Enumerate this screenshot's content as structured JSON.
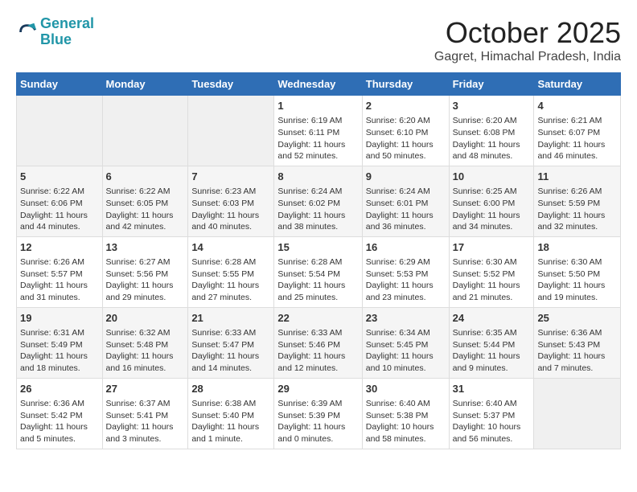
{
  "logo": {
    "line1": "General",
    "line2": "Blue"
  },
  "title": "October 2025",
  "subtitle": "Gagret, Himachal Pradesh, India",
  "weekdays": [
    "Sunday",
    "Monday",
    "Tuesday",
    "Wednesday",
    "Thursday",
    "Friday",
    "Saturday"
  ],
  "weeks": [
    [
      {
        "day": "",
        "info": ""
      },
      {
        "day": "",
        "info": ""
      },
      {
        "day": "",
        "info": ""
      },
      {
        "day": "1",
        "info": "Sunrise: 6:19 AM\nSunset: 6:11 PM\nDaylight: 11 hours\nand 52 minutes."
      },
      {
        "day": "2",
        "info": "Sunrise: 6:20 AM\nSunset: 6:10 PM\nDaylight: 11 hours\nand 50 minutes."
      },
      {
        "day": "3",
        "info": "Sunrise: 6:20 AM\nSunset: 6:08 PM\nDaylight: 11 hours\nand 48 minutes."
      },
      {
        "day": "4",
        "info": "Sunrise: 6:21 AM\nSunset: 6:07 PM\nDaylight: 11 hours\nand 46 minutes."
      }
    ],
    [
      {
        "day": "5",
        "info": "Sunrise: 6:22 AM\nSunset: 6:06 PM\nDaylight: 11 hours\nand 44 minutes."
      },
      {
        "day": "6",
        "info": "Sunrise: 6:22 AM\nSunset: 6:05 PM\nDaylight: 11 hours\nand 42 minutes."
      },
      {
        "day": "7",
        "info": "Sunrise: 6:23 AM\nSunset: 6:03 PM\nDaylight: 11 hours\nand 40 minutes."
      },
      {
        "day": "8",
        "info": "Sunrise: 6:24 AM\nSunset: 6:02 PM\nDaylight: 11 hours\nand 38 minutes."
      },
      {
        "day": "9",
        "info": "Sunrise: 6:24 AM\nSunset: 6:01 PM\nDaylight: 11 hours\nand 36 minutes."
      },
      {
        "day": "10",
        "info": "Sunrise: 6:25 AM\nSunset: 6:00 PM\nDaylight: 11 hours\nand 34 minutes."
      },
      {
        "day": "11",
        "info": "Sunrise: 6:26 AM\nSunset: 5:59 PM\nDaylight: 11 hours\nand 32 minutes."
      }
    ],
    [
      {
        "day": "12",
        "info": "Sunrise: 6:26 AM\nSunset: 5:57 PM\nDaylight: 11 hours\nand 31 minutes."
      },
      {
        "day": "13",
        "info": "Sunrise: 6:27 AM\nSunset: 5:56 PM\nDaylight: 11 hours\nand 29 minutes."
      },
      {
        "day": "14",
        "info": "Sunrise: 6:28 AM\nSunset: 5:55 PM\nDaylight: 11 hours\nand 27 minutes."
      },
      {
        "day": "15",
        "info": "Sunrise: 6:28 AM\nSunset: 5:54 PM\nDaylight: 11 hours\nand 25 minutes."
      },
      {
        "day": "16",
        "info": "Sunrise: 6:29 AM\nSunset: 5:53 PM\nDaylight: 11 hours\nand 23 minutes."
      },
      {
        "day": "17",
        "info": "Sunrise: 6:30 AM\nSunset: 5:52 PM\nDaylight: 11 hours\nand 21 minutes."
      },
      {
        "day": "18",
        "info": "Sunrise: 6:30 AM\nSunset: 5:50 PM\nDaylight: 11 hours\nand 19 minutes."
      }
    ],
    [
      {
        "day": "19",
        "info": "Sunrise: 6:31 AM\nSunset: 5:49 PM\nDaylight: 11 hours\nand 18 minutes."
      },
      {
        "day": "20",
        "info": "Sunrise: 6:32 AM\nSunset: 5:48 PM\nDaylight: 11 hours\nand 16 minutes."
      },
      {
        "day": "21",
        "info": "Sunrise: 6:33 AM\nSunset: 5:47 PM\nDaylight: 11 hours\nand 14 minutes."
      },
      {
        "day": "22",
        "info": "Sunrise: 6:33 AM\nSunset: 5:46 PM\nDaylight: 11 hours\nand 12 minutes."
      },
      {
        "day": "23",
        "info": "Sunrise: 6:34 AM\nSunset: 5:45 PM\nDaylight: 11 hours\nand 10 minutes."
      },
      {
        "day": "24",
        "info": "Sunrise: 6:35 AM\nSunset: 5:44 PM\nDaylight: 11 hours\nand 9 minutes."
      },
      {
        "day": "25",
        "info": "Sunrise: 6:36 AM\nSunset: 5:43 PM\nDaylight: 11 hours\nand 7 minutes."
      }
    ],
    [
      {
        "day": "26",
        "info": "Sunrise: 6:36 AM\nSunset: 5:42 PM\nDaylight: 11 hours\nand 5 minutes."
      },
      {
        "day": "27",
        "info": "Sunrise: 6:37 AM\nSunset: 5:41 PM\nDaylight: 11 hours\nand 3 minutes."
      },
      {
        "day": "28",
        "info": "Sunrise: 6:38 AM\nSunset: 5:40 PM\nDaylight: 11 hours\nand 1 minute."
      },
      {
        "day": "29",
        "info": "Sunrise: 6:39 AM\nSunset: 5:39 PM\nDaylight: 11 hours\nand 0 minutes."
      },
      {
        "day": "30",
        "info": "Sunrise: 6:40 AM\nSunset: 5:38 PM\nDaylight: 10 hours\nand 58 minutes."
      },
      {
        "day": "31",
        "info": "Sunrise: 6:40 AM\nSunset: 5:37 PM\nDaylight: 10 hours\nand 56 minutes."
      },
      {
        "day": "",
        "info": ""
      }
    ]
  ]
}
